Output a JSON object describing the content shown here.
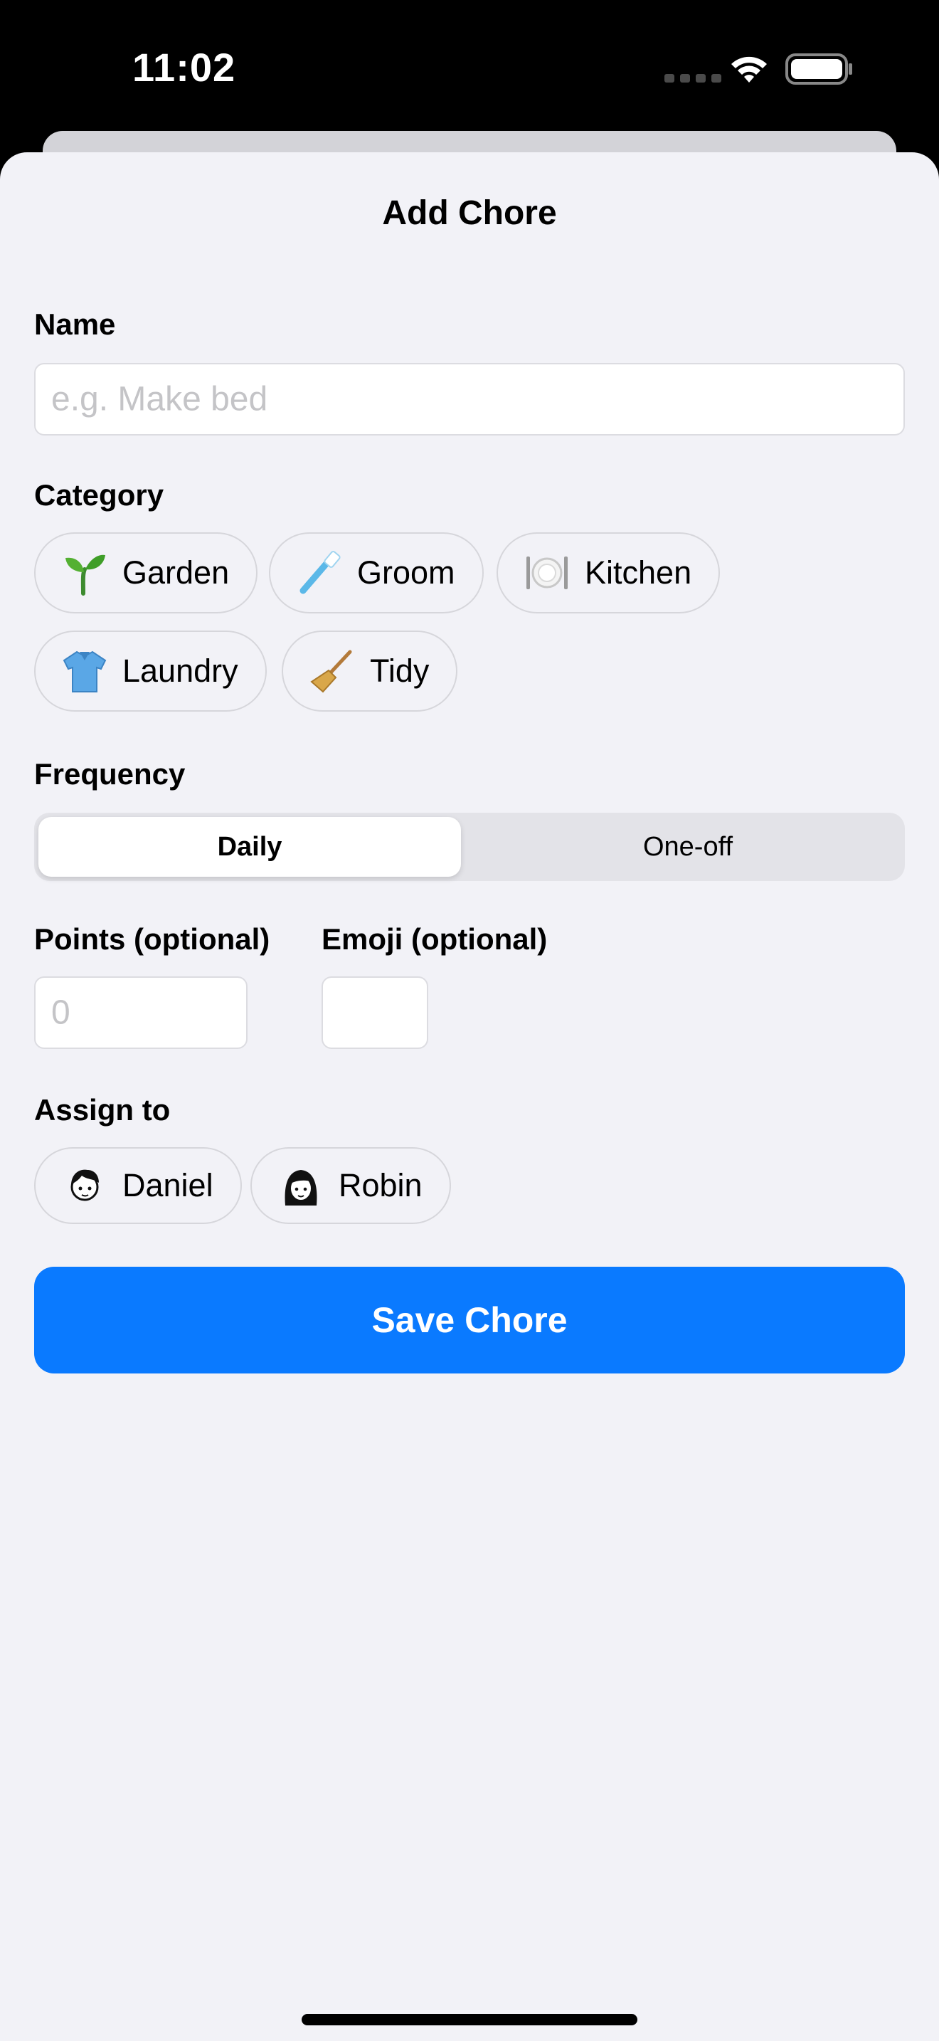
{
  "status_bar": {
    "time": "11:02",
    "wifi_icon": "wifi-icon",
    "battery_icon": "battery-icon"
  },
  "sheet": {
    "title": "Add Chore",
    "name": {
      "label": "Name",
      "placeholder": "e.g. Make bed"
    },
    "category": {
      "label": "Category",
      "options": [
        {
          "emoji": "seedling-icon",
          "label": "Garden"
        },
        {
          "emoji": "toothbrush-icon",
          "label": "Groom"
        },
        {
          "emoji": "plate-cutlery-icon",
          "label": "Kitchen"
        },
        {
          "emoji": "shirt-icon",
          "label": "Laundry"
        },
        {
          "emoji": "broom-icon",
          "label": "Tidy"
        }
      ]
    },
    "frequency": {
      "label": "Frequency",
      "options": [
        "Daily",
        "One-off"
      ],
      "selected": "Daily"
    },
    "points": {
      "label": "Points (optional)",
      "placeholder": "0"
    },
    "emoji": {
      "label": "Emoji (optional)",
      "value": ""
    },
    "assign_to": {
      "label": "Assign to",
      "people": [
        {
          "avatar": "avatar-icon",
          "name": "Daniel"
        },
        {
          "avatar": "avatar-icon",
          "name": "Robin"
        }
      ]
    },
    "save_label": "Save Chore"
  },
  "colors": {
    "accent": "#0A7AFF",
    "background": "#F2F2F7",
    "border": "#D6D6DB"
  }
}
